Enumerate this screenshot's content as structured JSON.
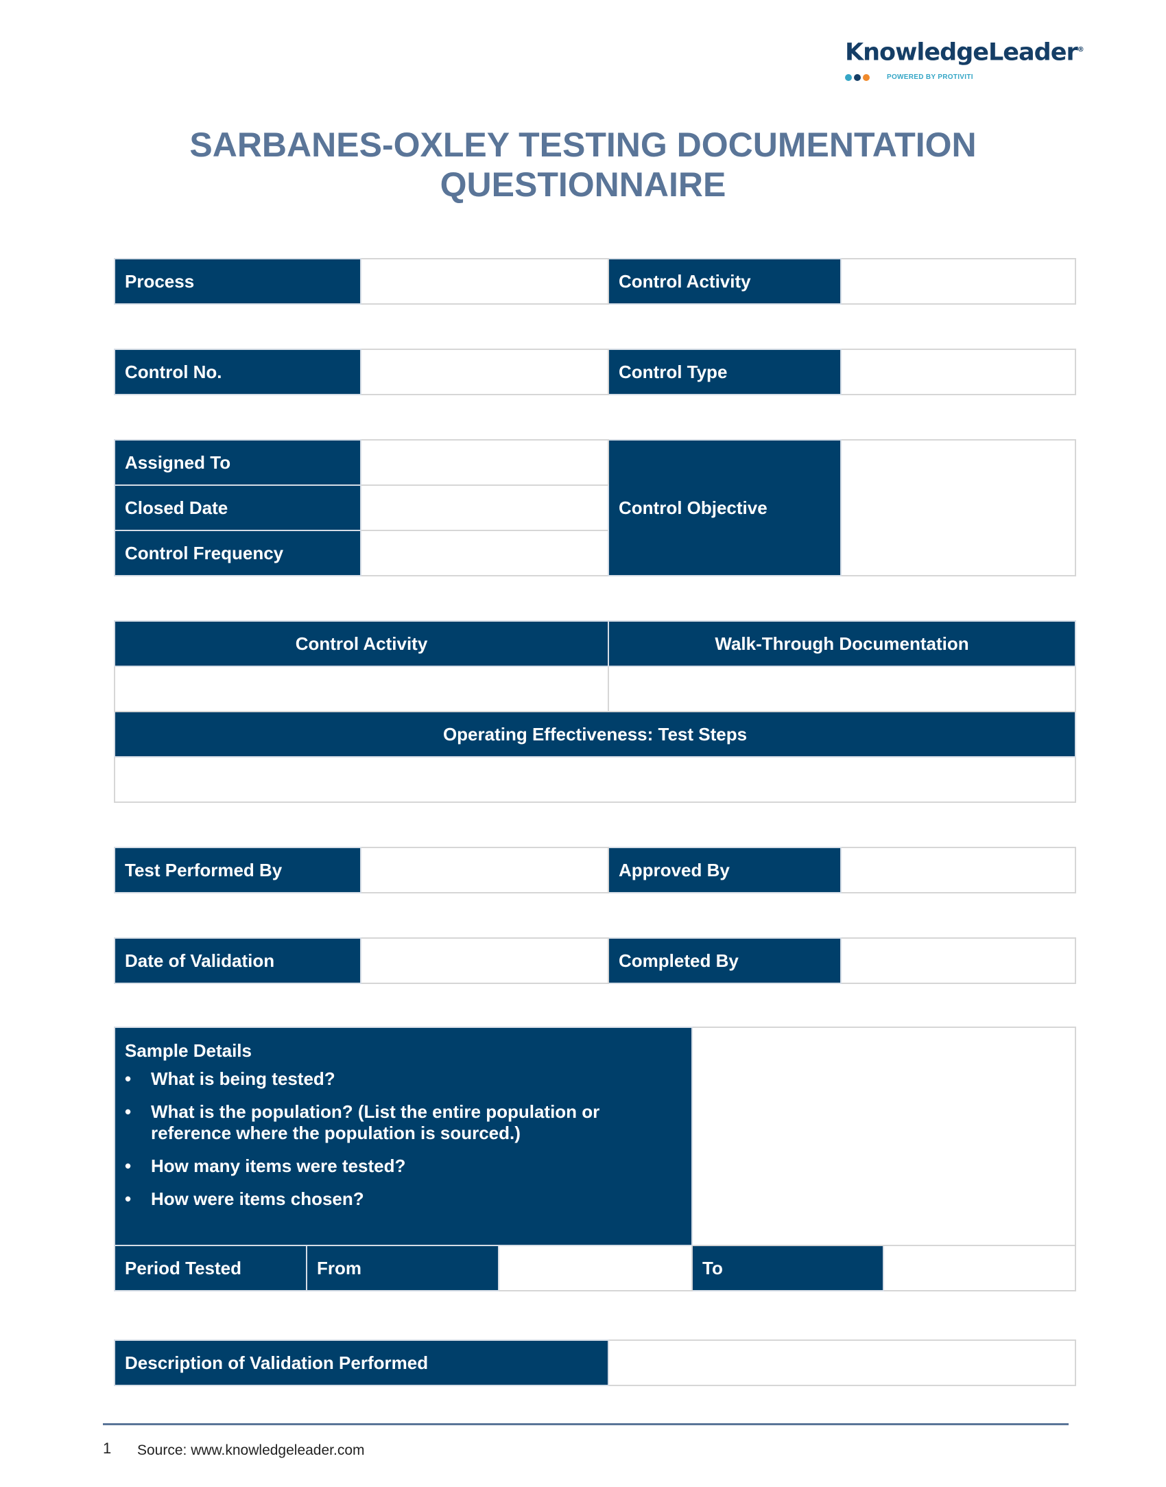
{
  "logo": {
    "wordmark": "KnowledgeLeader",
    "registered_mark": "®",
    "tagline": "POWERED BY PROTIVITI",
    "dot_colors": [
      "#35a6c6",
      "#153e66",
      "#f08a2c"
    ]
  },
  "title": {
    "line1": "SARBANES-OXLEY TESTING DOCUMENTATION",
    "line2": "QUESTIONNAIRE"
  },
  "colors": {
    "header_fill": "#003f6a",
    "title_text": "#5a7598",
    "border": "#d6d6d6"
  },
  "section_process": {
    "process_label": "Process",
    "process_value": "",
    "control_activity_label": "Control Activity",
    "control_activity_value": ""
  },
  "section_control": {
    "control_no_label": "Control No.",
    "control_no_value": "",
    "control_type_label": "Control Type",
    "control_type_value": ""
  },
  "section_assignment": {
    "assigned_to_label": "Assigned To",
    "assigned_to_value": "",
    "closed_date_label": "Closed Date",
    "closed_date_value": "",
    "control_frequency_label": "Control Frequency",
    "control_frequency_value": "",
    "control_objective_label": "Control Objective",
    "control_objective_value": ""
  },
  "section_walkthrough": {
    "control_activity_header": "Control Activity",
    "walkthrough_header": "Walk-Through Documentation",
    "control_activity_value": "",
    "walkthrough_value": "",
    "test_steps_header": "Operating Effectiveness: Test Steps",
    "test_steps_value": ""
  },
  "section_signoff": {
    "test_performed_by_label": "Test Performed By",
    "test_performed_by_value": "",
    "approved_by_label": "Approved By",
    "approved_by_value": ""
  },
  "section_validation": {
    "date_of_validation_label": "Date of Validation",
    "date_of_validation_value": "",
    "completed_by_label": "Completed By",
    "completed_by_value": ""
  },
  "section_sample": {
    "title": "Sample Details",
    "bullet": "•",
    "questions": [
      "What is being tested?",
      "What is the population? (List the entire population or reference where the population is sourced.)",
      "How many items were tested?",
      "How were items chosen?"
    ],
    "sample_value": "",
    "period_tested_label": "Period Tested",
    "from_label": "From",
    "from_value": "",
    "to_label": "To",
    "to_value": ""
  },
  "section_description": {
    "label": "Description of Validation Performed",
    "value": ""
  },
  "footer": {
    "page_number": "1",
    "source": "Source: www.knowledgeleader.com"
  }
}
